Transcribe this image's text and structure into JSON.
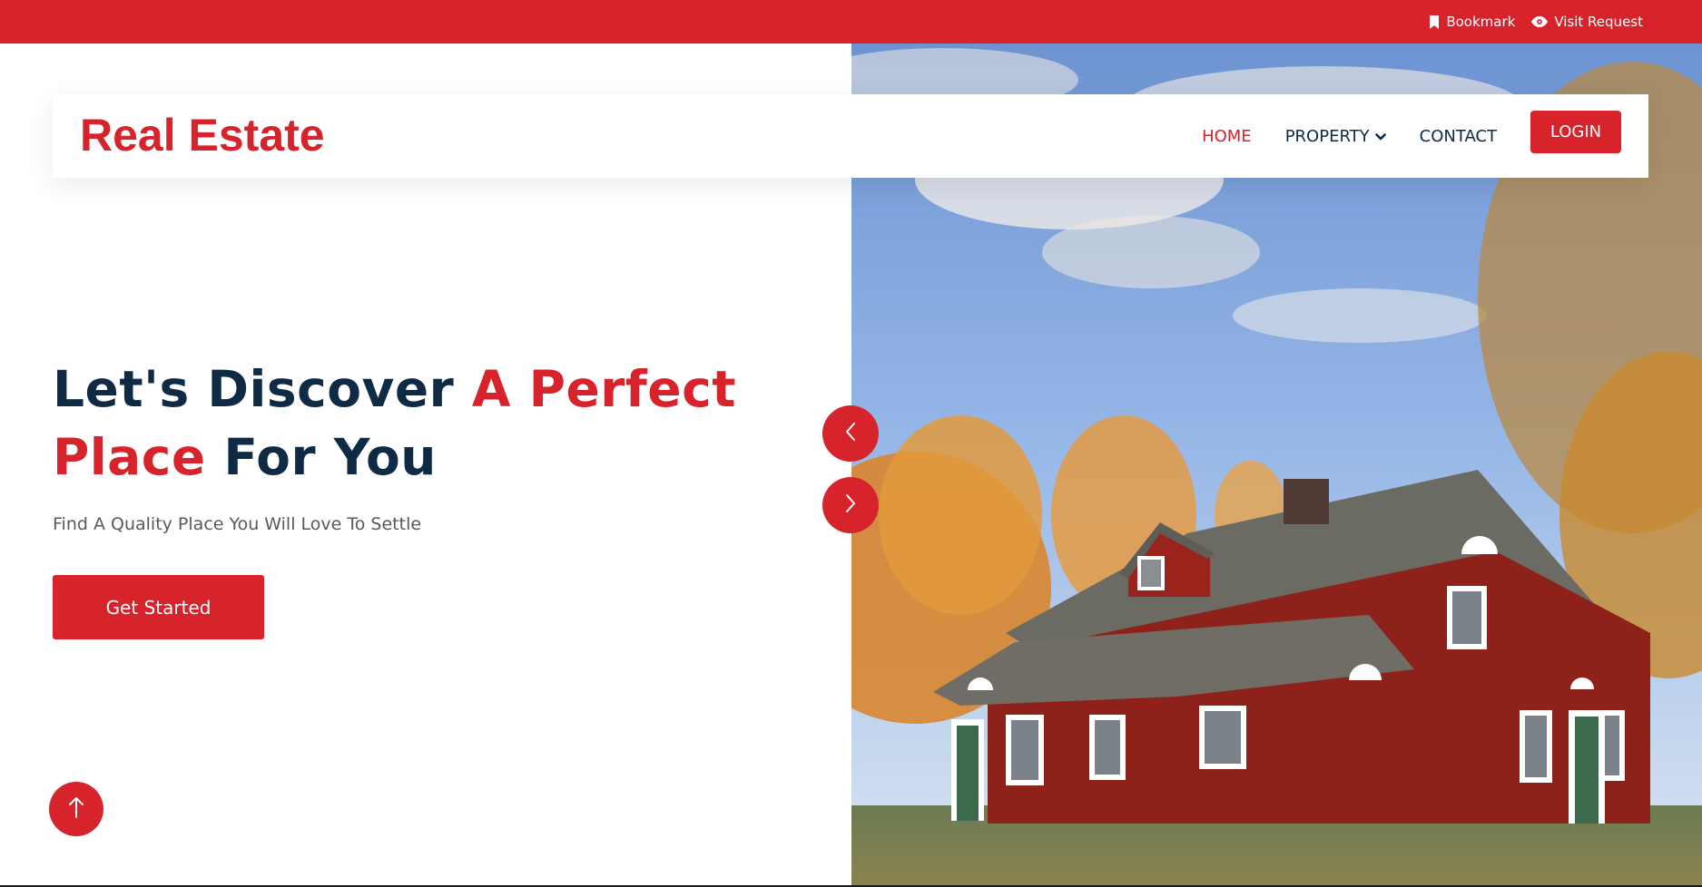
{
  "topbar": {
    "bookmark_label": "Bookmark",
    "bookmark_icon": "bookmark-icon",
    "visit_label": "Visit Request",
    "visit_icon": "eye-icon",
    "background": "#d7232b"
  },
  "navbar": {
    "brand": "Real Estate",
    "links": [
      {
        "label": "HOME",
        "active": true
      },
      {
        "label": "PROPERTY",
        "has_dropdown": true
      },
      {
        "label": "CONTACT"
      }
    ],
    "login_label": "LOGIN"
  },
  "hero": {
    "headline_part1": "Let's Discover ",
    "headline_accent1": "A Perfect",
    "headline_accent2": "Place",
    "headline_part2": " For You",
    "subheading": "Find A Quality Place You Will Love To Settle",
    "cta_label": "Get Started",
    "image_subject": "red wooden house with autumn trees under blue sky"
  },
  "controls": {
    "prev_icon": "chevron-left-icon",
    "next_icon": "chevron-right-icon",
    "scroll_top_icon": "arrow-up-icon"
  },
  "colors": {
    "accent": "#d7232b",
    "navy": "#0f2a44",
    "muted_text": "#555a60"
  }
}
